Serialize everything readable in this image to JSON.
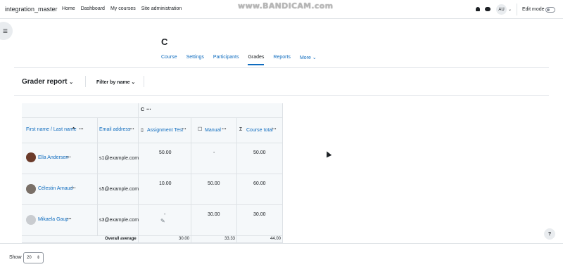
{
  "navbar": {
    "brand": "integration_master",
    "links": [
      "Home",
      "Dashboard",
      "My courses",
      "Site administration"
    ],
    "watermark": "www.BANDICAM.com",
    "avatar_initials": "AU",
    "edit_mode_label": "Edit mode"
  },
  "course": {
    "title": "C",
    "tabs": [
      "Course",
      "Settings",
      "Participants",
      "Grades",
      "Reports",
      "More"
    ],
    "active_tab": "Grades"
  },
  "toolbar": {
    "report_label": "Grader report",
    "filter_label": "Filter by name"
  },
  "grid": {
    "category_name": "C",
    "col_name": "First name / Last name",
    "col_email": "Email address",
    "col_assignment": "Assignment Test",
    "col_manual": "Manual",
    "col_total": "Course total",
    "rows": [
      {
        "name": "Ella Andersen",
        "email": "s1@example.com",
        "assignment": "50.00",
        "manual": "-",
        "total": "50.00"
      },
      {
        "name": "Célestin Arnaud",
        "email": "s5@example.com",
        "assignment": "10.00",
        "manual": "50.00",
        "total": "60.00"
      },
      {
        "name": "Mikaela Gaup",
        "email": "s3@example.com",
        "assignment": "-",
        "manual": "30.00",
        "total": "30.00"
      }
    ],
    "overall_label": "Overall average",
    "overall": {
      "assignment": "30.00",
      "manual": "33.33",
      "total": "44.00"
    }
  },
  "footer": {
    "show_label": "Show",
    "show_value": "20"
  },
  "help": "?",
  "colors": {
    "link": "#0f6cbf",
    "border": "#dee2e6",
    "row_shade": "#f5f8fa"
  }
}
